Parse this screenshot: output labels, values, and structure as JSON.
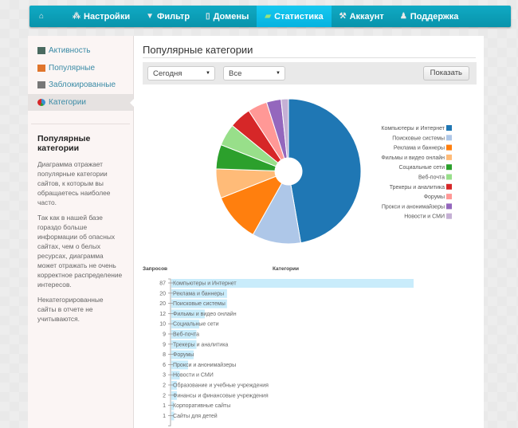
{
  "nav": {
    "items": [
      {
        "label": "",
        "icon": "home-icon",
        "active": false
      },
      {
        "label": "Настройки",
        "icon": "settings-icon",
        "active": false
      },
      {
        "label": "Фильтр",
        "icon": "filter-icon",
        "active": false
      },
      {
        "label": "Домены",
        "icon": "document-icon",
        "active": false
      },
      {
        "label": "Статистика",
        "icon": "chart-icon",
        "active": true
      },
      {
        "label": "Аккаунт",
        "icon": "wrench-icon",
        "active": false
      },
      {
        "label": "Поддержка",
        "icon": "user-icon",
        "active": false
      }
    ]
  },
  "sidebar": {
    "items": [
      {
        "label": "Активность",
        "icon": "monitor-icon",
        "active": false
      },
      {
        "label": "Популярные",
        "icon": "bar-chart-icon",
        "active": false
      },
      {
        "label": "Заблокированные",
        "icon": "blocked-chart-icon",
        "active": false
      },
      {
        "label": "Категории",
        "icon": "pie-chart-icon",
        "active": true
      }
    ],
    "info_title": "Популярные категории",
    "paragraphs": [
      "Диаграмма отражает популярные категории сайтов, к которым вы обращаетесь наиболее часто.",
      "Так как в нашей базе гораздо больше информации об опасных сайтах, чем о белых ресурсах, диаграмма может отражать не очень корректное распределение интересов.",
      "Некатегорированные сайты в отчете не учитываются."
    ]
  },
  "main": {
    "title": "Популярные категории",
    "period": "Сегодня",
    "filter": "Все",
    "show_label": "Показать"
  },
  "chart_data": [
    {
      "type": "pie",
      "donut": true,
      "legend_position": "right",
      "categories": [
        "Компьютеры и Интернет",
        "Поисковые системы",
        "Реклама и баннеры",
        "Фильмы и видео онлайн",
        "Социальные сети",
        "Веб-почта",
        "Трекеры и аналитика",
        "Форумы",
        "Прокси и анонимайзеры",
        "Новости и СМИ"
      ],
      "values": [
        87,
        20,
        20,
        12,
        10,
        9,
        9,
        8,
        6,
        3
      ],
      "colors": [
        "#1f77b4",
        "#aec7e8",
        "#ff7f0e",
        "#ffbb78",
        "#2ca02c",
        "#98df8a",
        "#d62728",
        "#ff9896",
        "#9467bd",
        "#c5b0d5"
      ]
    },
    {
      "type": "bar",
      "orientation": "horizontal",
      "ylabel": "Запросов",
      "xlabel": "Категории",
      "bar_color": "#c9ecfb",
      "categories": [
        "Компьютеры и Интернет",
        "Реклама и баннеры",
        "Поисковые системы",
        "Фильмы и видео онлайн",
        "Социальные сети",
        "Веб-почта",
        "Трекеры и аналитика",
        "Форумы",
        "Прокси и анонимайзеры",
        "Новости и СМИ",
        "Образование и учебные учреждения",
        "Финансы и финансовые учреждения",
        "Корпоративные сайты",
        "Сайты для детей"
      ],
      "values": [
        87,
        20,
        20,
        12,
        10,
        9,
        9,
        8,
        6,
        3,
        2,
        2,
        1,
        1
      ]
    }
  ]
}
